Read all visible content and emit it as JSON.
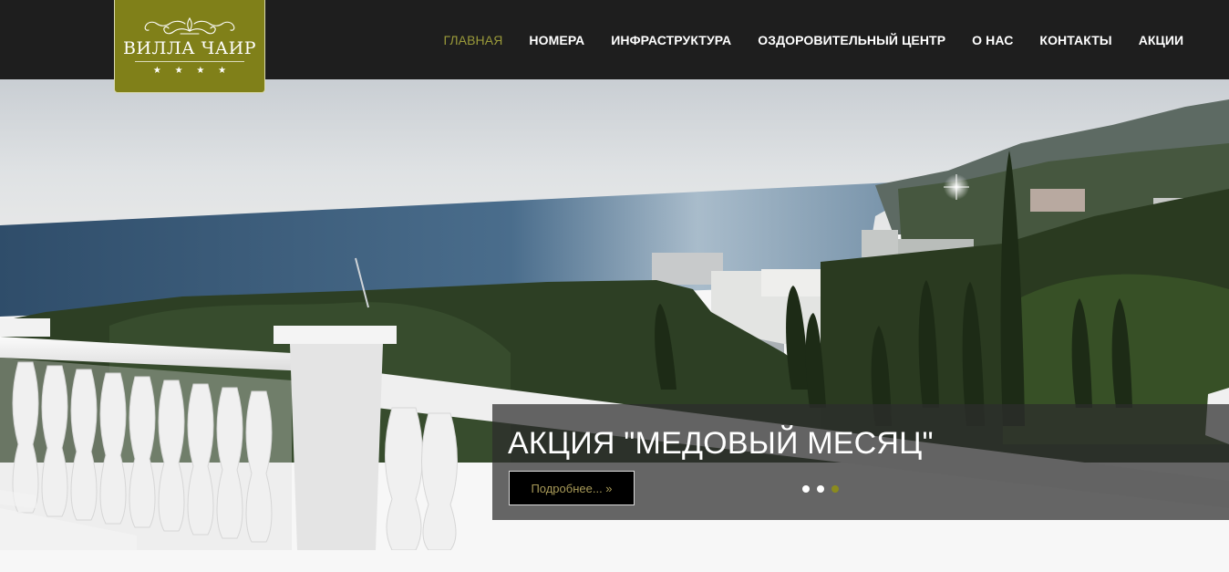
{
  "logo": {
    "name": "ВИЛЛА ЧАИР",
    "stars": "★ ★ ★ ★",
    "background": "#808019"
  },
  "nav": {
    "items": [
      {
        "label": "ГЛАВНАЯ",
        "active": true
      },
      {
        "label": "НОМЕРА",
        "active": false
      },
      {
        "label": "ИНФРАСТРУКТУРА",
        "active": false
      },
      {
        "label": "ОЗДОРОВИТЕЛЬНЫЙ ЦЕНТР",
        "active": false
      },
      {
        "label": "О НАС",
        "active": false
      },
      {
        "label": "КОНТАКТЫ",
        "active": false
      },
      {
        "label": "АКЦИИ",
        "active": false
      }
    ],
    "active_color": "#9a9a3a"
  },
  "slider": {
    "caption_title": "АКЦИЯ \"МЕДОВЫЙ МЕСЯЦ\"",
    "button_label": "Подробнее... »",
    "slide_count": 3,
    "active_slide": 3
  },
  "colors": {
    "header_bg": "#1e1e1e",
    "accent": "#8b8b1e"
  }
}
